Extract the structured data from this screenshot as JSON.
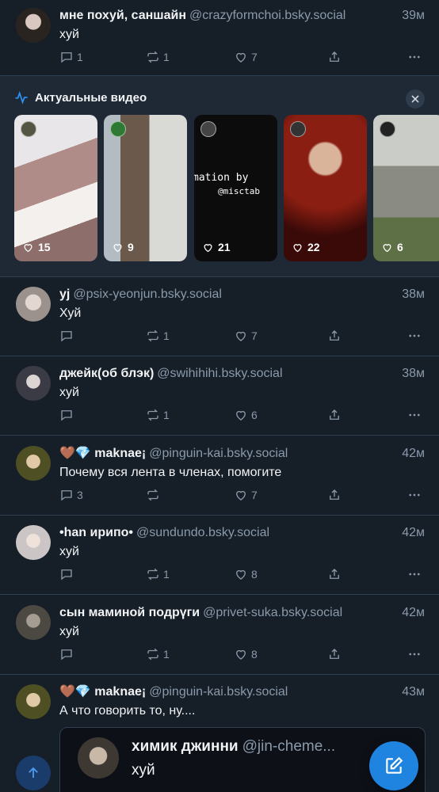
{
  "posts": [
    {
      "name": "мне похуй, саншайн",
      "handle": "@crazyformchoi.bsky.social",
      "time": "39м",
      "text": "хуй",
      "replies": "1",
      "reposts": "1",
      "likes": "7",
      "avatar_color": "#3b3330"
    },
    {
      "name": "yj",
      "handle": "@psix-yeonjun.bsky.social",
      "time": "38м",
      "text": "Хуй",
      "replies": "",
      "reposts": "1",
      "likes": "7",
      "avatar_color": "#b6aaa3"
    },
    {
      "name": "джейк(об блэк)",
      "handle": "@swihihihi.bsky.social",
      "time": "38м",
      "text": "хуй",
      "replies": "",
      "reposts": "1",
      "likes": "6",
      "avatar_color": "#6d7180"
    },
    {
      "name": "maknae¡",
      "handle": "@pinguin-kai.bsky.social",
      "time": "42м",
      "text": "Почему вся лента в членах, помогите",
      "replies": "3",
      "reposts": "",
      "likes": "7",
      "avatar_color": "#6b6a2e"
    },
    {
      "name": "•han ирипо•",
      "handle": "@sundundo.bsky.social",
      "time": "42м",
      "text": "хуй",
      "replies": "",
      "reposts": "1",
      "likes": "8",
      "avatar_color": "#d9d4d2"
    },
    {
      "name": "сын маминой подрүги",
      "handle": "@privet-suka.bsky.social",
      "time": "42м",
      "text": "хуй",
      "replies": "",
      "reposts": "1",
      "likes": "8",
      "avatar_color": "#5e5a54"
    },
    {
      "name": "maknae¡",
      "handle": "@pinguin-kai.bsky.social",
      "time": "43м",
      "text": "А что говорить то, ну....",
      "avatar_color": "#6b6a2e"
    }
  ],
  "trending": {
    "title": "Актуальные видео",
    "videos": [
      {
        "likes": "15",
        "bg": "#c8a9a6"
      },
      {
        "likes": "9",
        "bg": "#5f5c57"
      },
      {
        "likes": "21",
        "bg": "#0c0c0d",
        "overlay": "mation by",
        "overlay2": "@misctab"
      },
      {
        "likes": "22",
        "bg": "#5a1510"
      },
      {
        "likes": "6",
        "bg": "#7a7c76"
      }
    ]
  },
  "emojis": {
    "heart": "🤎",
    "gem": "💎"
  },
  "quote": {
    "name": "химик джинни",
    "handle": "@jin-cheme...",
    "text": "хуй",
    "avatar_color": "#6a6055"
  },
  "colors": {
    "background": "#161e27",
    "accent": "#1f84e0",
    "muted": "#8a9aab"
  }
}
